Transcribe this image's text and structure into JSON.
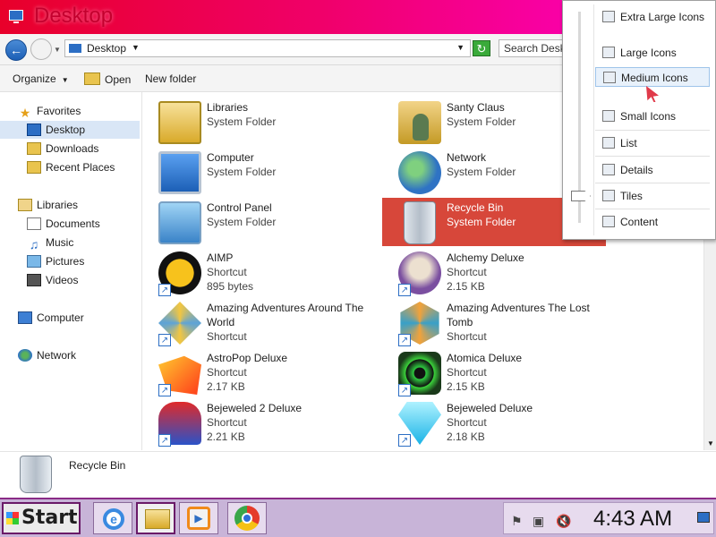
{
  "window": {
    "title": "Desktop"
  },
  "address": {
    "location": "Desktop",
    "search_placeholder": "Search Desktop"
  },
  "toolbar": {
    "organize": "Organize",
    "open": "Open",
    "new_folder": "New folder"
  },
  "nav": {
    "favorites": "Favorites",
    "desktop": "Desktop",
    "downloads": "Downloads",
    "recent": "Recent Places",
    "libraries": "Libraries",
    "documents": "Documents",
    "music": "Music",
    "pictures": "Pictures",
    "videos": "Videos",
    "computer": "Computer",
    "network": "Network"
  },
  "items": [
    {
      "name": "Libraries",
      "line2": "System Folder",
      "line3": ""
    },
    {
      "name": "Santy Claus",
      "line2": "System Folder",
      "line3": ""
    },
    {
      "name": "Computer",
      "line2": "System Folder",
      "line3": ""
    },
    {
      "name": "Network",
      "line2": "System Folder",
      "line3": ""
    },
    {
      "name": "Control Panel",
      "line2": "System Folder",
      "line3": ""
    },
    {
      "name": "Recycle Bin",
      "line2": "System Folder",
      "line3": ""
    },
    {
      "name": "AIMP",
      "line2": "Shortcut",
      "line3": "895 bytes"
    },
    {
      "name": "Alchemy Deluxe",
      "line2": "Shortcut",
      "line3": "2.15 KB"
    },
    {
      "name": "Amazing Adventures Around The",
      "line2": "World",
      "line3": "Shortcut"
    },
    {
      "name": "Amazing Adventures The Lost",
      "line2": "Tomb",
      "line3": "Shortcut"
    },
    {
      "name": "AstroPop Deluxe",
      "line2": "Shortcut",
      "line3": "2.17 KB"
    },
    {
      "name": "Atomica Deluxe",
      "line2": "Shortcut",
      "line3": "2.15 KB"
    },
    {
      "name": "Bejeweled 2 Deluxe",
      "line2": "Shortcut",
      "line3": "2.21 KB"
    },
    {
      "name": "Bejeweled Deluxe",
      "line2": "Shortcut",
      "line3": "2.18 KB"
    }
  ],
  "details": {
    "selected_name": "Recycle Bin"
  },
  "view_menu": {
    "extra_large": "Extra Large Icons",
    "large": "Large Icons",
    "medium": "Medium Icons",
    "small": "Small Icons",
    "list": "List",
    "details": "Details",
    "tiles": "Tiles",
    "content": "Content",
    "current": "Tiles"
  },
  "taskbar": {
    "start": "Start",
    "clock": "4:43 AM"
  },
  "colors": {
    "selection": "#d7473a",
    "titlebar": "#f0006a",
    "taskbar": "#c8b4d8"
  }
}
